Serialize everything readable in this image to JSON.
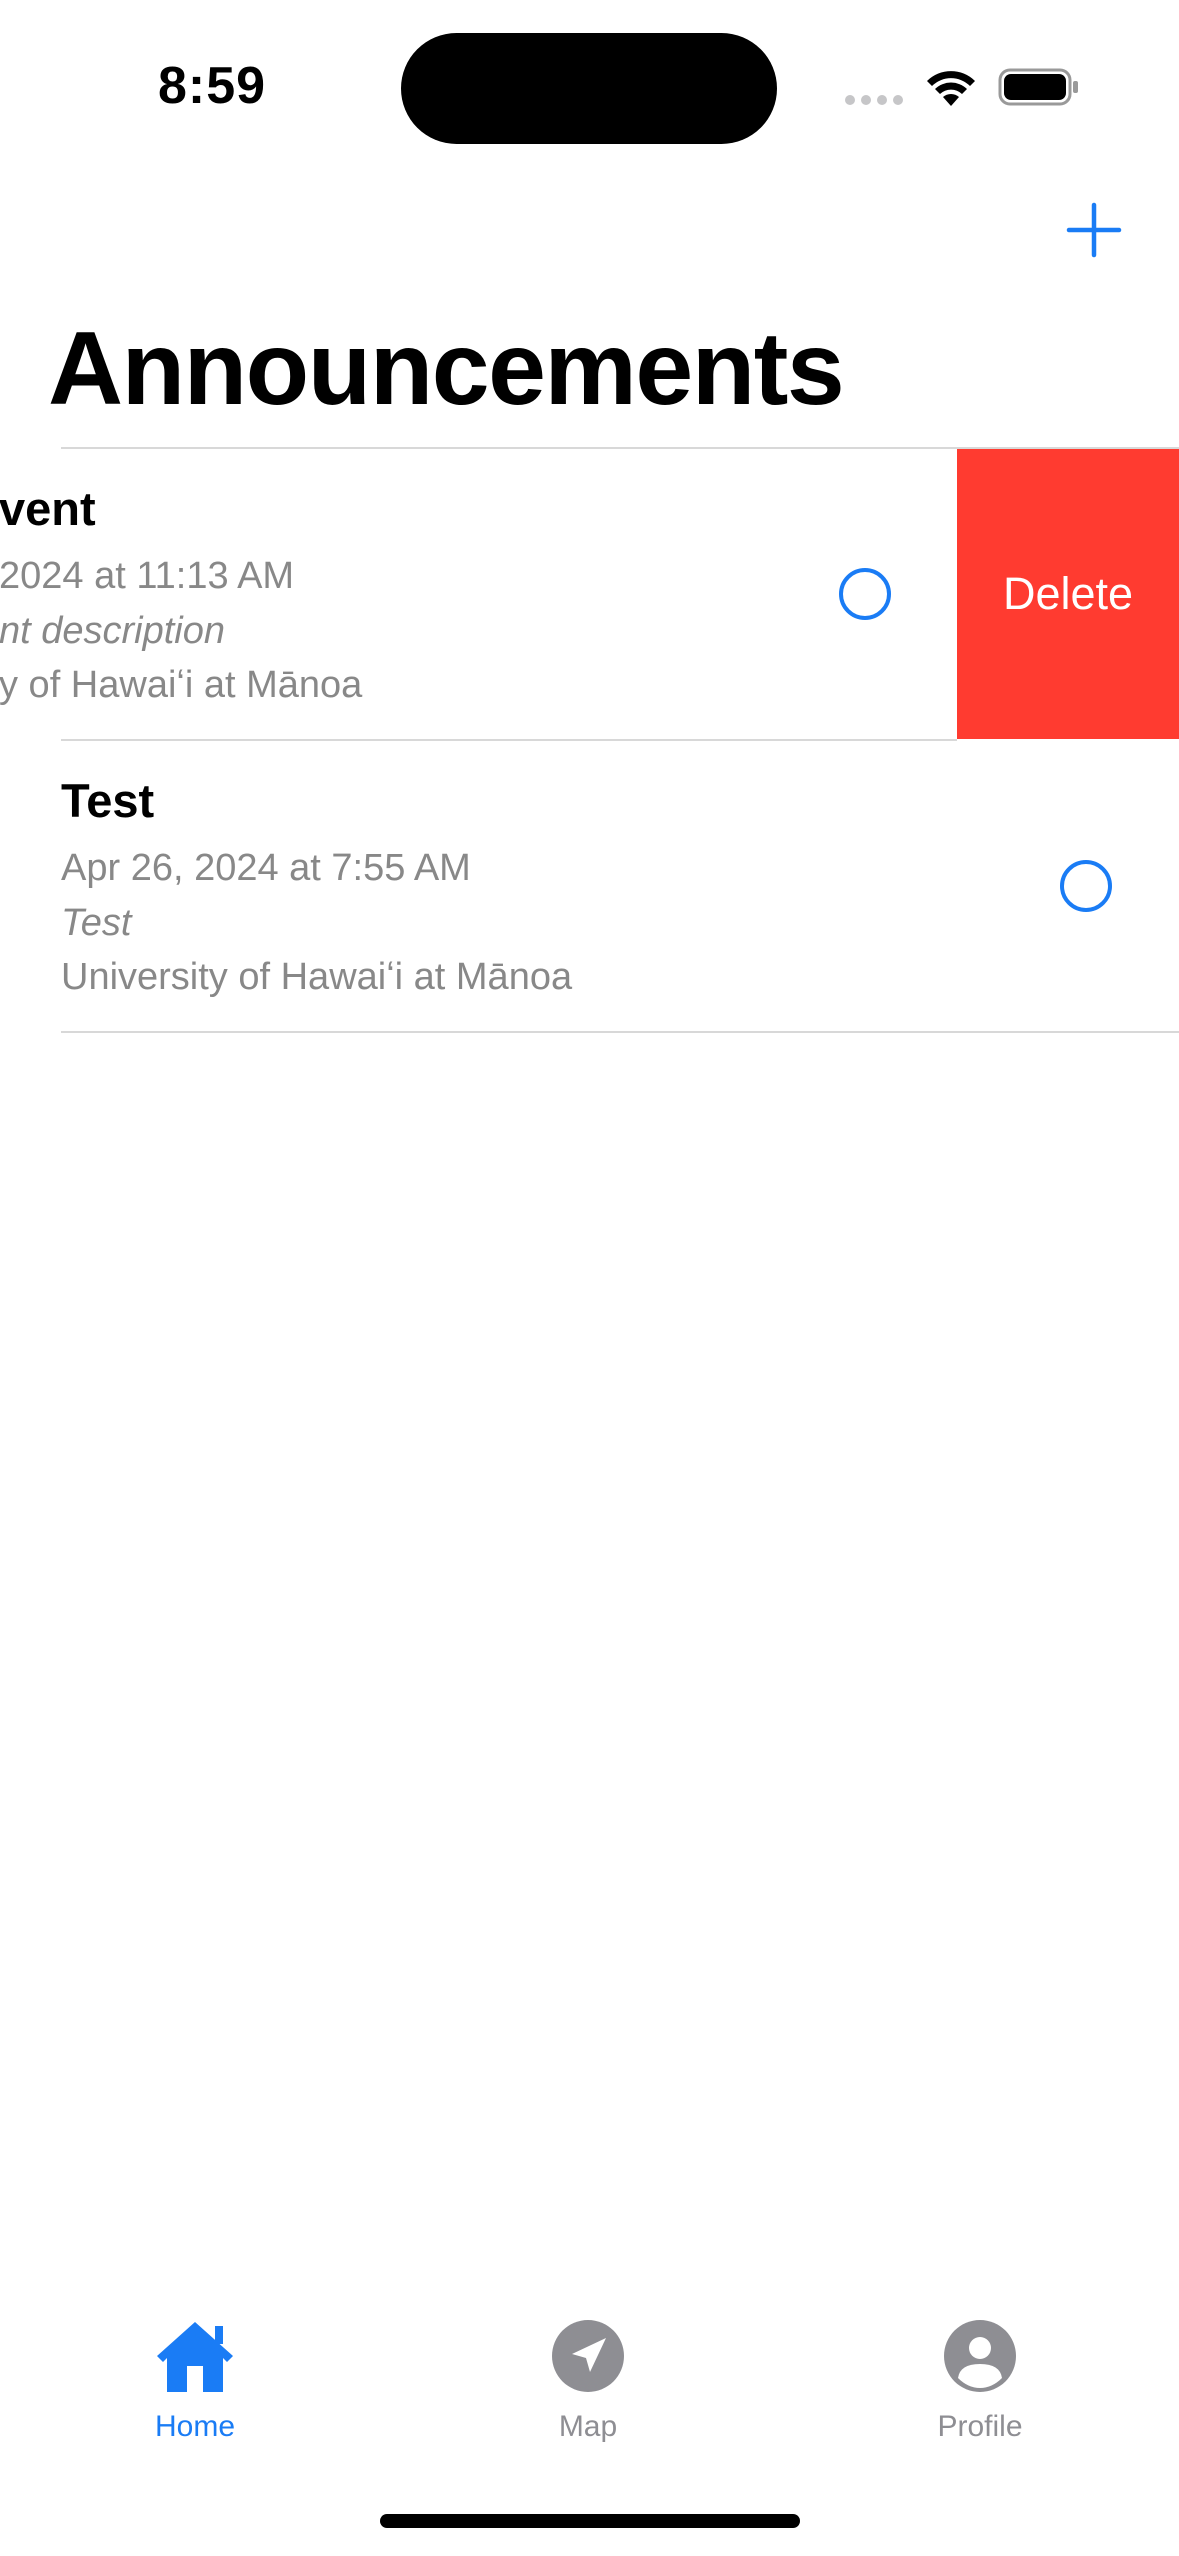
{
  "status_bar": {
    "time": "8:59"
  },
  "nav": {
    "add_icon": "plus-icon",
    "title": "Announcements"
  },
  "announcements": [
    {
      "title": "vent",
      "date": "2024 at 11:13 AM",
      "description": "nt description",
      "organization": "y of Hawaiʻi at Mānoa",
      "swiped": true
    },
    {
      "title": "Test",
      "date": "Apr 26, 2024 at 7:55 AM",
      "description": "Test",
      "organization": "University of Hawaiʻi at Mānoa",
      "swiped": false
    }
  ],
  "swipe_action": {
    "label": "Delete",
    "color": "#ff3b30"
  },
  "tab_bar": {
    "active_color": "#1a7cf5",
    "inactive_color": "#8e8e93",
    "tabs": [
      {
        "label": "Home",
        "icon": "house-icon",
        "active": true
      },
      {
        "label": "Map",
        "icon": "location-arrow-icon",
        "active": false
      },
      {
        "label": "Profile",
        "icon": "person-circle-icon",
        "active": false
      }
    ]
  }
}
